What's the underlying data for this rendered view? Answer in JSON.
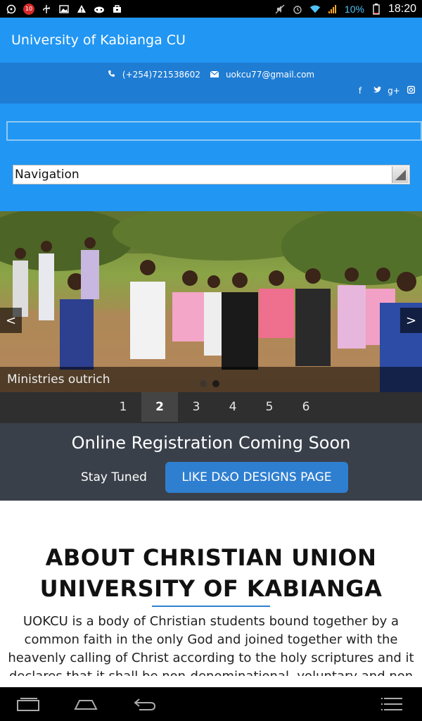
{
  "status_bar": {
    "left_icons": [
      "whatsapp-icon",
      "notification-badge-icon",
      "usb-icon",
      "gallery-icon",
      "warning-icon",
      "game-icon",
      "bag-icon"
    ],
    "badge_text": "10",
    "right_icons": [
      "mute-icon",
      "alarm-icon",
      "wifi-icon",
      "signal-icon",
      "battery-icon"
    ],
    "battery_percent": "10%",
    "time": "18:20"
  },
  "app": {
    "title": "University of Kabianga CU",
    "accent_color": "#2196f3",
    "contact_bar_color": "#1f7cd3"
  },
  "contact": {
    "phone": "(+254)721538602",
    "email": "uokcu77@gmail.com",
    "social": [
      "facebook-icon",
      "twitter-icon",
      "google-plus-icon",
      "instagram-icon"
    ]
  },
  "search": {
    "placeholder": ""
  },
  "navigation": {
    "selected": "Navigation"
  },
  "slider": {
    "caption": "Ministries outrich",
    "prev_label": "<",
    "next_label": ">",
    "dot_count": 2
  },
  "pager": {
    "pages": [
      "1",
      "2",
      "3",
      "4",
      "5",
      "6"
    ],
    "active_page": "2"
  },
  "registration": {
    "title": "Online Registration Coming Soon",
    "subtitle": "Stay Tuned",
    "button_label": "LIKE D&O DESIGNS PAGE",
    "button_color": "#2f7fd0",
    "band_color": "#3a404a"
  },
  "about": {
    "title_line1": "ABOUT CHRISTIAN UNION",
    "title_line2": "UNIVERSITY OF KABIANGA",
    "text": "UOKCU is a body of Christian students bound together by a common faith in the only God and joined together with the heavenly calling of Christ according to the holy scriptures and it declares that it shall be non-denominational, voluntary and non"
  },
  "android_nav": [
    "recent-apps-icon",
    "home-icon",
    "back-icon",
    "menu-icon"
  ]
}
